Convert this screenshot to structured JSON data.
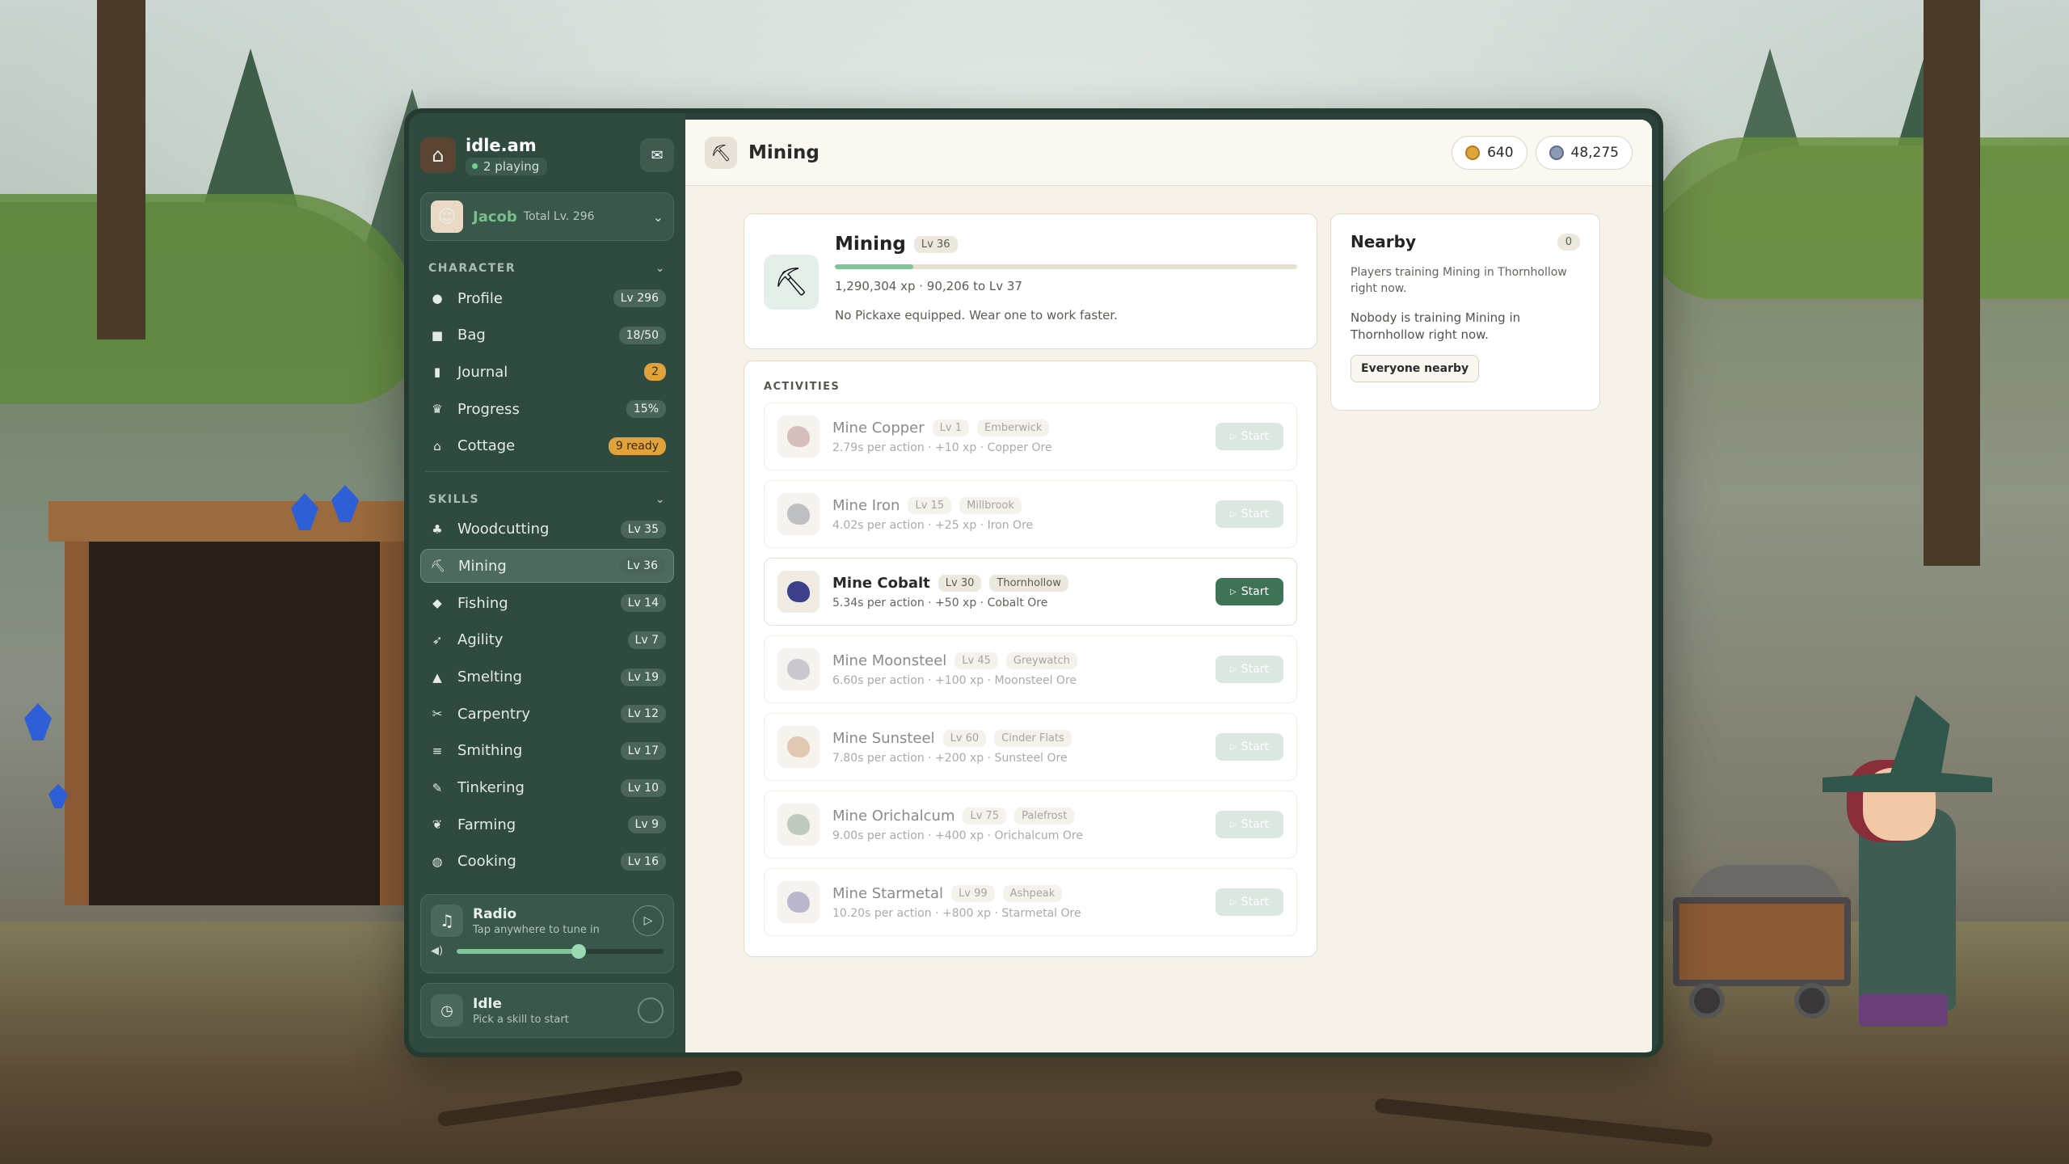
{
  "app": {
    "name": "idle.am",
    "online": "2 playing",
    "mail_icon": "mail-icon"
  },
  "character": {
    "name": "Jacob",
    "total": "Total Lv. 296"
  },
  "sections": {
    "character": "CHARACTER",
    "skills": "SKILLS"
  },
  "character_nav": [
    {
      "label": "Profile",
      "badge": "Lv 296",
      "icon": "person-icon"
    },
    {
      "label": "Bag",
      "badge": "18/50",
      "icon": "bag-icon"
    },
    {
      "label": "Journal",
      "badge": "2",
      "icon": "journal-icon",
      "badge_color": "#e1a23a"
    },
    {
      "label": "Progress",
      "badge": "15%",
      "icon": "trophy-icon"
    },
    {
      "label": "Cottage",
      "badge": "9 ready",
      "icon": "cottage-icon",
      "badge_color": "#e1a23a"
    }
  ],
  "skills_nav": [
    {
      "label": "Woodcutting",
      "badge": "Lv 35",
      "icon": "tree-icon"
    },
    {
      "label": "Mining",
      "badge": "Lv 36",
      "icon": "pickaxe-icon",
      "active": true
    },
    {
      "label": "Fishing",
      "badge": "Lv 14",
      "icon": "fish-icon"
    },
    {
      "label": "Agility",
      "badge": "Lv 7",
      "icon": "runner-icon"
    },
    {
      "label": "Smelting",
      "badge": "Lv 19",
      "icon": "furnace-icon"
    },
    {
      "label": "Carpentry",
      "badge": "Lv 12",
      "icon": "saw-icon"
    },
    {
      "label": "Smithing",
      "badge": "Lv 17",
      "icon": "anvil-icon"
    },
    {
      "label": "Tinkering",
      "badge": "Lv 10",
      "icon": "wrench-icon"
    },
    {
      "label": "Farming",
      "badge": "Lv 9",
      "icon": "sprout-icon"
    },
    {
      "label": "Cooking",
      "badge": "Lv 16",
      "icon": "pot-icon"
    }
  ],
  "radio": {
    "title": "Radio",
    "subtitle": "Tap anywhere to tune in",
    "volume": 0.59
  },
  "idle": {
    "title": "Idle",
    "subtitle": "Pick a skill to start"
  },
  "header": {
    "title": "Mining",
    "gold": "640",
    "silver": "48,275"
  },
  "skill": {
    "title": "Mining",
    "level": "Lv 36",
    "progress": 0.17,
    "xp": "1,290,304 xp · 90,206 to Lv 37",
    "note": "No Pickaxe equipped. Wear one to work faster."
  },
  "activities": {
    "heading": "ACTIVITIES",
    "start_label": "Start",
    "items": [
      {
        "name": "Mine Copper",
        "level": "Lv 1",
        "location": "Emberwick",
        "detail": "2.79s per action · +10 xp · Copper Ore",
        "ore_color": "#b98a83",
        "available": false
      },
      {
        "name": "Mine Iron",
        "level": "Lv 15",
        "location": "Millbrook",
        "detail": "4.02s per action · +25 xp · Iron Ore",
        "ore_color": "#8a8c90",
        "available": false
      },
      {
        "name": "Mine Cobalt",
        "level": "Lv 30",
        "location": "Thornhollow",
        "detail": "5.34s per action · +50 xp · Cobalt Ore",
        "ore_color": "#3c3f8a",
        "available": true
      },
      {
        "name": "Mine Moonsteel",
        "level": "Lv 45",
        "location": "Greywatch",
        "detail": "6.60s per action · +100 xp · Moonsteel Ore",
        "ore_color": "#a49aa8",
        "available": false
      },
      {
        "name": "Mine Sunsteel",
        "level": "Lv 60",
        "location": "Cinder Flats",
        "detail": "7.80s per action · +200 xp · Sunsteel Ore",
        "ore_color": "#c59a74",
        "available": false
      },
      {
        "name": "Mine Orichalcum",
        "level": "Lv 75",
        "location": "Palefrost",
        "detail": "9.00s per action · +400 xp · Orichalcum Ore",
        "ore_color": "#8aa08e",
        "available": false
      },
      {
        "name": "Mine Starmetal",
        "level": "Lv 99",
        "location": "Ashpeak",
        "detail": "10.20s per action · +800 xp · Starmetal Ore",
        "ore_color": "#857ea3",
        "available": false
      }
    ]
  },
  "nearby": {
    "title": "Nearby",
    "count": "0",
    "description": "Players training Mining in Thornhollow right now.",
    "empty": "Nobody is training Mining in Thornhollow right now.",
    "button": "Everyone nearby"
  }
}
